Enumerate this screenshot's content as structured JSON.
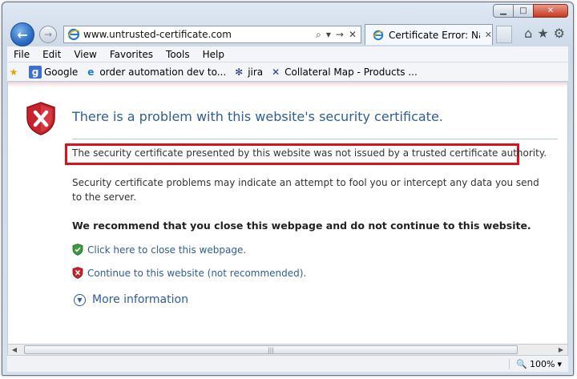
{
  "window": {
    "caption": {
      "minimize_glyph": "▁",
      "maximize_glyph": "□",
      "close_glyph": "✕"
    }
  },
  "navigation": {
    "back_glyph": "←",
    "forward_glyph": "→",
    "address": {
      "url": "www.untrusted-certificate.com",
      "tools": [
        "⌕",
        "▾",
        "→",
        "✕"
      ]
    },
    "tab": {
      "title": "Certificate Error: Navi...",
      "close_glyph": "✕"
    },
    "right_tools": {
      "home_icon": "home-icon",
      "favorites_icon": "star-icon",
      "tools_icon": "gear-icon"
    }
  },
  "menubar": {
    "items": [
      "File",
      "Edit",
      "View",
      "Favorites",
      "Tools",
      "Help"
    ]
  },
  "favorites_bar": {
    "items": [
      {
        "label": "Google",
        "icon": "google-icon"
      },
      {
        "label": "order automation dev to...",
        "icon": "ie-page-icon"
      },
      {
        "label": "jira",
        "icon": "jira-icon"
      },
      {
        "label": "Collateral Map - Products ...",
        "icon": "collateral-icon"
      }
    ]
  },
  "content": {
    "title": "There is a problem with this website's security certificate.",
    "highlighted_text": "The security certificate presented by this website was not issued by a trusted certificate authority.",
    "explanation": "Security certificate problems may indicate an attempt to fool you or intercept any data you send to the server.",
    "recommendation": "We recommend that you close this webpage and do not continue to this website.",
    "close_link": "Click here to close this webpage.",
    "continue_link": "Continue to this website (not recommended).",
    "more_info": "More information"
  },
  "statusbar": {
    "zoom": "100%"
  },
  "colors": {
    "title_blue": "#2e5d9a",
    "highlight_red": "#d9141a",
    "shield_red": "#c8232c",
    "shield_green": "#3d9a3c"
  }
}
